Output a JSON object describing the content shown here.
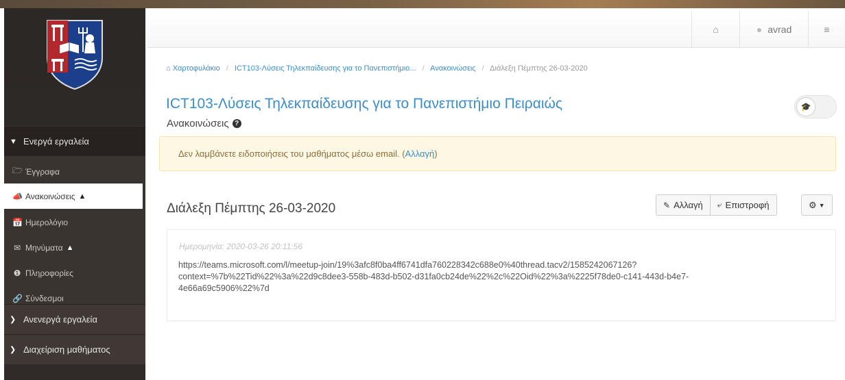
{
  "header": {
    "user_name": "avrad",
    "icons": [
      "home-icon",
      "user-icon",
      "sliders-icon"
    ]
  },
  "sidebar": {
    "active_group": "Ενεργά εργαλεία",
    "items": [
      {
        "label": "Έγγραφα",
        "icon": "folder-open-icon"
      },
      {
        "label": "Ανακοινώσεις",
        "icon": "bullhorn-icon",
        "warn": true,
        "current": true
      },
      {
        "label": "Ημερολόγιο",
        "icon": "calendar-icon"
      },
      {
        "label": "Μηνύματα",
        "icon": "envelope-icon",
        "warn": true
      },
      {
        "label": "Πληροφορίες",
        "icon": "info-icon"
      },
      {
        "label": "Σύνδεσμοι",
        "icon": "link-icon"
      }
    ],
    "inactive_group": "Ανενεργά εργαλεία",
    "manage_group": "Διαχείριση μαθήματος"
  },
  "breadcrumb": {
    "portfolio": "Χαρτοφυλάκιο",
    "course": "ICT103-Λύσεις Τηλεκπαίδευσης για το Πανεπιστήμιο...",
    "section": "Ανακοινώσεις",
    "current": "Διάλεξη Πέμπτης 26-03-2020"
  },
  "main": {
    "course_title": "ICT103-Λύσεις Τηλεκπαίδευσης για το Πανεπιστήμιο Πειραιώς",
    "section_title": "Ανακοινώσεις",
    "alert_text": "Δεν λαμβάνετε ειδοποιήσεις του μαθήματος μέσω email. (",
    "alert_link": "Αλλαγή",
    "alert_end": ")"
  },
  "announcement": {
    "title": "Διάλεξη Πέμπτης 26-03-2020",
    "edit_label": "Αλλαγή",
    "back_label": "Επιστροφή",
    "date": "Ημερομηνία: 2020-03-26 20:11:56",
    "body_line1": "https://teams.microsoft.com/l/meetup-join/19%3afc8f0ba4ff6741dfa760228342c688e0%40thread.tacv2/1585242067126?",
    "body_line2": "context=%7b%22Tid%22%3a%22d9c8dee3-558b-483d-b502-d31fa0cb24de%22%2c%22Oid%22%3a%2225f78de0-c141-443d-b4e7-",
    "body_line3": "4e66a69c5906%22%7d"
  },
  "colors": {
    "accent": "#3a8dcb",
    "sidebar": "#2c2826",
    "alert_bg": "#fcf8e3"
  }
}
